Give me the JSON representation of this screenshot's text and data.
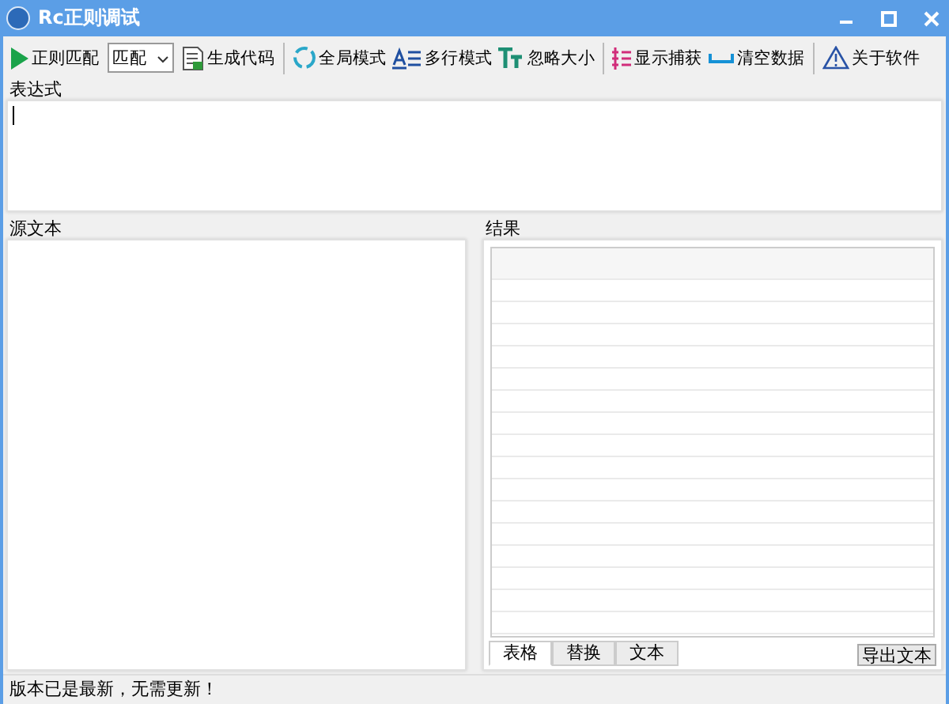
{
  "window": {
    "title": "Rc正则调试"
  },
  "toolbar": [
    {
      "kind": "button",
      "label": "正则匹配"
    },
    {
      "kind": "select",
      "value": "匹配"
    },
    {
      "kind": "button",
      "label": "生成代码"
    },
    {
      "kind": "separator"
    },
    {
      "kind": "button",
      "label": "全局模式"
    },
    {
      "kind": "button",
      "label": "多行模式"
    },
    {
      "kind": "button",
      "label": "忽略大小"
    },
    {
      "kind": "separator"
    },
    {
      "kind": "button",
      "label": "显示捕获"
    },
    {
      "kind": "button",
      "label": "清空数据"
    },
    {
      "kind": "separator"
    },
    {
      "kind": "button",
      "label": "关于软件"
    }
  ],
  "expression": {
    "label": "表达式"
  },
  "source": {
    "label": "源文本"
  },
  "result": {
    "label": "结果",
    "tabs": [
      {
        "label": "表格",
        "selected": true
      },
      {
        "label": "替换",
        "selected": false
      },
      {
        "label": "文本",
        "selected": false
      }
    ],
    "export_button": "导出文本"
  },
  "status_bar": "版本已是最新，无需更新！"
}
